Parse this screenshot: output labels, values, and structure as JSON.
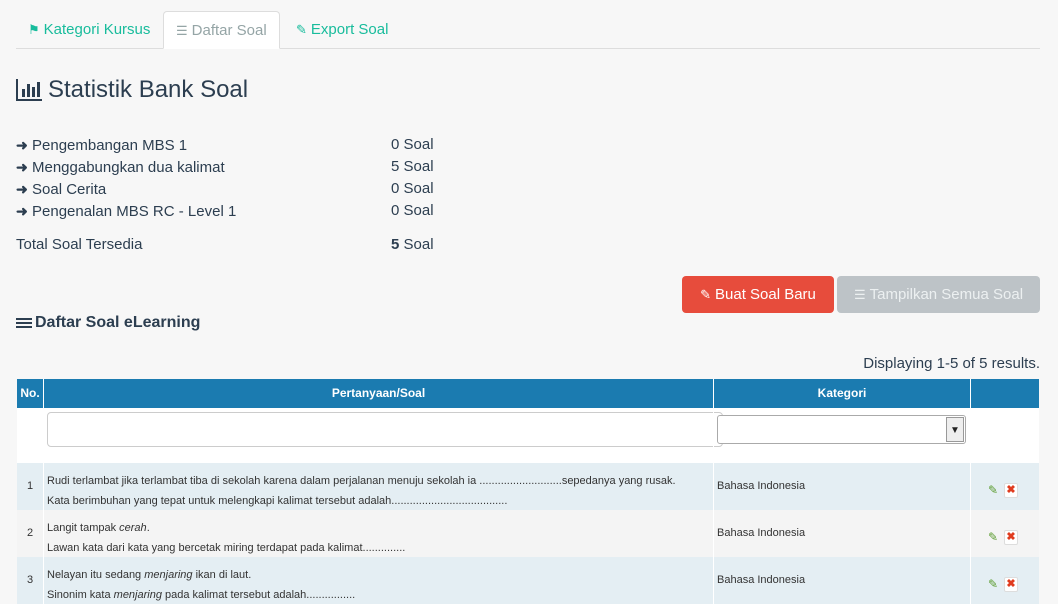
{
  "tabs": [
    {
      "label": "Kategori Kursus",
      "icon": "bookmark-icon"
    },
    {
      "label": "Daftar Soal",
      "icon": "list-icon"
    },
    {
      "label": "Export Soal",
      "icon": "pencil-icon"
    }
  ],
  "stats": {
    "title": "Statistik Bank Soal",
    "items": [
      {
        "label": "Pengembangan MBS 1",
        "count": "0 Soal"
      },
      {
        "label": "Menggabungkan dua kalimat",
        "count": "5 Soal"
      },
      {
        "label": "Soal Cerita",
        "count": "0 Soal"
      },
      {
        "label": "Pengenalan MBS RC - Level 1",
        "count": "0 Soal"
      }
    ],
    "total_label": "Total Soal Tersedia",
    "total_number": "5",
    "total_unit": " Soal"
  },
  "buttons": {
    "create": "Buat Soal Baru",
    "show_all": "Tampilkan Semua Soal"
  },
  "list_title": "Daftar Soal eLearning",
  "summary": "Displaying 1-5 of 5 results.",
  "table": {
    "headers": {
      "no": "No.",
      "question": "Pertanyaan/Soal",
      "category": "Kategori"
    },
    "rows": [
      {
        "no": "1",
        "line1": "Rudi terlambat jika terlambat tiba di sekolah karena dalam perjalanan menuju sekolah ia ...........................sepedanya yang rusak.",
        "line2": "Kata berimbuhan yang tepat untuk melengkapi kalimat tersebut adalah......................................",
        "category": "Bahasa Indonesia"
      },
      {
        "no": "2",
        "line1_pre": "Langit tampak ",
        "line1_em": "cerah",
        "line1_post": ".",
        "line2": "Lawan kata dari kata yang bercetak miring terdapat pada kalimat..............",
        "category": "Bahasa Indonesia"
      },
      {
        "no": "3",
        "line1_pre": "Nelayan itu sedang ",
        "line1_em": "menjaring",
        "line1_post": " ikan di laut.",
        "line2_pre": "Sinonim kata ",
        "line2_em": "menjaring",
        "line2_post": " pada kalimat tersebut adalah................",
        "category": "Bahasa Indonesia"
      }
    ]
  }
}
